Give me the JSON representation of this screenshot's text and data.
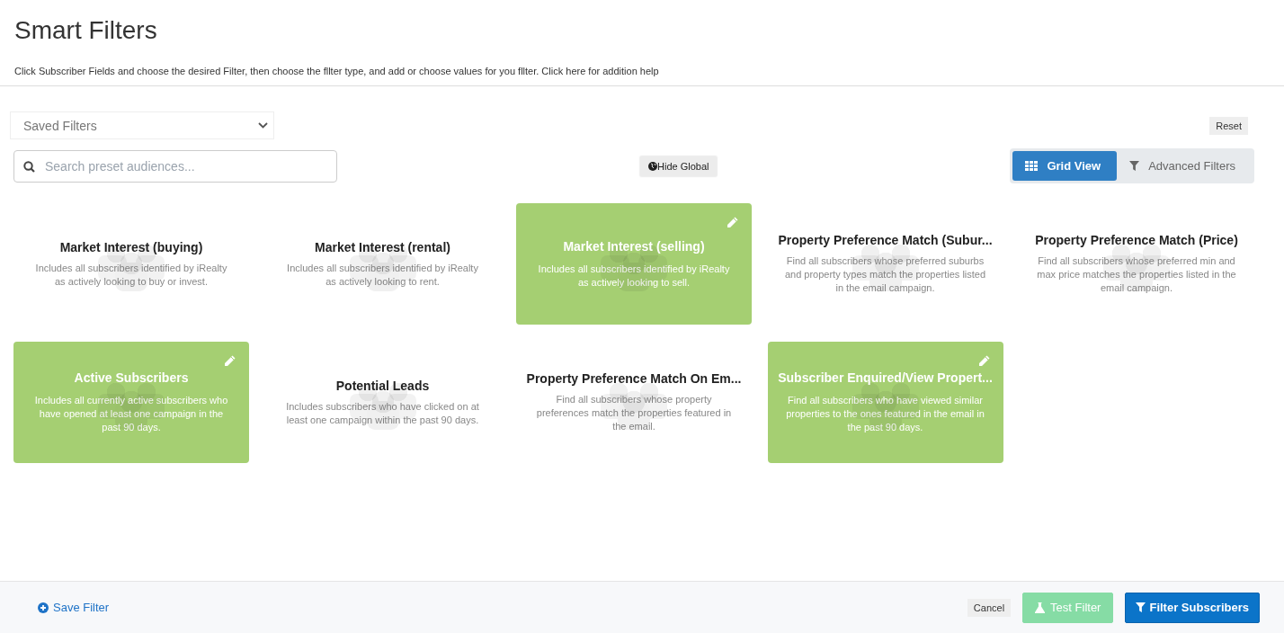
{
  "header": {
    "title": "Smart Filters",
    "description": "Click Subscriber Fields and choose the desired Filter, then choose the fllter type, and add or choose values for you fllter. Click here for addition help"
  },
  "saved_filters": {
    "value": "Saved Filters"
  },
  "reset_button": "Reset",
  "search": {
    "placeholder": "Search preset audiences..."
  },
  "hide_global_button": "Hide Global",
  "view_tabs": [
    {
      "label": "Grid View",
      "selected": true,
      "kind": "grid"
    },
    {
      "label": "Advanced Filters",
      "selected": false,
      "kind": "filter"
    }
  ],
  "filter_cards": [
    {
      "title": "Market Interest (buying)",
      "description": "Includes all subscribers identified by iRealty as actively looking to buy or invest.",
      "selected": false
    },
    {
      "title": "Market Interest (rental)",
      "description": "Includes all subscribers identified by iRealty as actively looking to rent.",
      "selected": false
    },
    {
      "title": "Market Interest (selling)",
      "description": "Includes all subscribers identified by iRealty as actively looking to sell.",
      "selected": true
    },
    {
      "title": "Property Preference Match (Subur...",
      "description": "Find all subscribers whose preferred suburbs and property types match the properties listed in the email campaign.",
      "selected": false
    },
    {
      "title": "Property Preference Match (Price)",
      "description": "Find all subscribers whose preferred min and max price matches the properties listed in the email campaign.",
      "selected": false
    },
    {
      "title": "Active Subscribers",
      "description": "Includes all currently active subscribers who have opened at least one campaign in the past 90 days.",
      "selected": true
    },
    {
      "title": "Potential Leads",
      "description": "Includes subscribers who have clicked on at least one campaign within the past 90 days.",
      "selected": false
    },
    {
      "title": "Property Preference Match On Em...",
      "description": "Find all subscribers whose property preferences match the properties featured in the email.",
      "selected": false
    },
    {
      "title": "Subscriber Enquired/View Propert...",
      "description": "Find all subscribers who have viewed similar properties to the ones featured in the email in the past 90 days.",
      "selected": true
    }
  ],
  "footer": {
    "save_filter": "Save Filter",
    "cancel": "Cancel",
    "test_filter": {
      "label": "Test Filter",
      "disabled": true
    },
    "filter_subscribers": "Filter Subscribers"
  }
}
